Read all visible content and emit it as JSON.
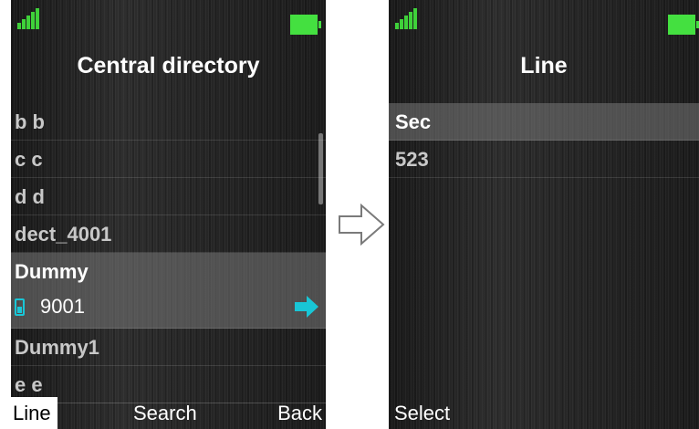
{
  "colors": {
    "signal": "#3fd13a",
    "battery": "#44e040",
    "accent_cyan": "#19c6d6",
    "highlight": "#787878",
    "text": "#ffffff",
    "muted_text": "#c8c8c8"
  },
  "left_screen": {
    "title": "Central directory",
    "status_icons": [
      "signal-icon",
      "battery-icon"
    ],
    "items": [
      {
        "label": "b b"
      },
      {
        "label": "c c"
      },
      {
        "label": "d d"
      },
      {
        "label": "dect_4001"
      },
      {
        "label": "Dummy",
        "number": "9001",
        "selected": true,
        "icons": [
          "phone-icon",
          "arrow-right-icon"
        ]
      },
      {
        "label": "Dummy1"
      },
      {
        "label": "e e"
      }
    ],
    "softkeys": {
      "left": "Line",
      "center": "Search",
      "right": "Back"
    }
  },
  "flow_arrow": "arrow-right-outline-icon",
  "right_screen": {
    "title": "Line",
    "status_icons": [
      "signal-icon",
      "battery-icon"
    ],
    "items": [
      {
        "label": "Sec",
        "selected": true
      },
      {
        "label": "523"
      }
    ],
    "softkeys": {
      "left": "Select"
    }
  }
}
